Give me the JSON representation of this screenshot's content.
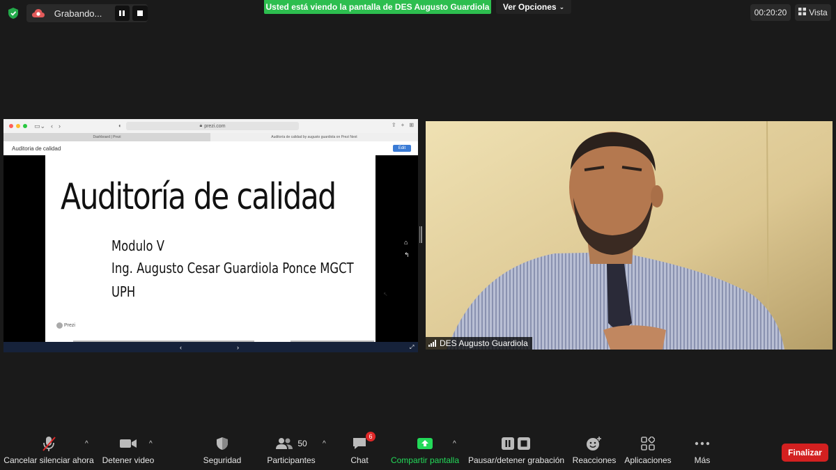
{
  "top_bar": {
    "recording_label": "Grabando...",
    "banner_text": "Usted está viendo la pantalla de DES Augusto Guardiola",
    "view_options_label": "Ver Opciones",
    "timer": "00:20:20",
    "view_label": "Vista"
  },
  "shared_screen": {
    "browser_url": "prezi.com",
    "tabs": [
      "Dashboard | Prezi",
      "Auditoría de calidad by augusto guardiola on Prezi Next"
    ],
    "prezi_title": "Auditoria de calidad",
    "edit_label": "Edit",
    "slide": {
      "title": "Auditoría de calidad",
      "lines": [
        "Modulo V",
        "Ing. Augusto Cesar Guardiola Ponce MGCT",
        "UPH"
      ]
    },
    "prezi_logo": "Prezi"
  },
  "participant": {
    "name": "DES Augusto Guardiola"
  },
  "toolbar": {
    "items": [
      {
        "label": "Cancelar silenciar ahora",
        "icon": "mic-muted-icon"
      },
      {
        "label": "Detener video",
        "icon": "video-camera-icon"
      },
      {
        "label": "Seguridad",
        "icon": "shield-icon"
      },
      {
        "label": "Participantes",
        "icon": "participants-icon",
        "count": "50"
      },
      {
        "label": "Chat",
        "icon": "chat-icon",
        "badge": "6"
      },
      {
        "label": "Compartir pantalla",
        "icon": "share-screen-icon"
      },
      {
        "label": "Pausar/detener grabación",
        "icon": "pause-stop-icon"
      },
      {
        "label": "Reacciones",
        "icon": "emoji-icon"
      },
      {
        "label": "Aplicaciones",
        "icon": "apps-icon"
      },
      {
        "label": "Más",
        "icon": "more-icon"
      }
    ],
    "end_label": "Finalizar"
  },
  "colors": {
    "banner_green": "#2dbe4f",
    "end_red": "#d32020",
    "share_green": "#23d959",
    "badge_red": "#e02828"
  }
}
